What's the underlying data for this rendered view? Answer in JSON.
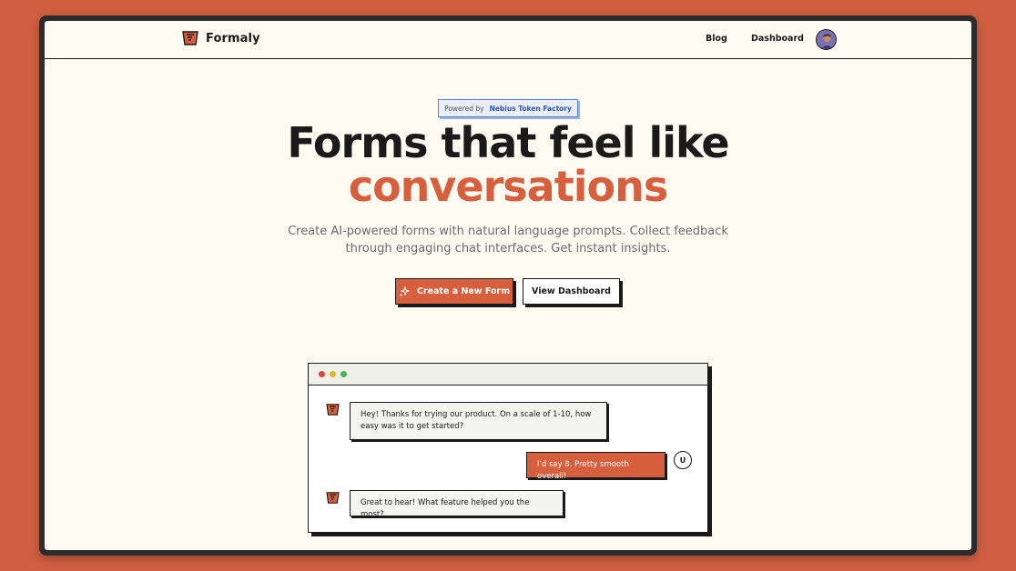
{
  "nav": {
    "brand": "Formaly",
    "links": [
      "Blog",
      "Dashboard"
    ],
    "avatar_icon": "user-avatar-icon"
  },
  "hero": {
    "badge_prefix": "Powered by",
    "badge_accent": "Nebius Token Factory",
    "title": "Forms that feel like",
    "title_accent": "conversations",
    "subtitle": "Create AI-powered forms with natural language prompts. Collect feedback through engaging chat interfaces. Get instant insights.",
    "primary_button": "Create a New Form",
    "secondary_button": "View Dashboard"
  },
  "chat": {
    "messages": [
      {
        "from": "bot",
        "text": "Hey! Thanks for trying our product. On a scale of 1-10, how easy was it to get started?"
      },
      {
        "from": "user",
        "text": "I'd say 8. Pretty smooth overall!"
      },
      {
        "from": "bot",
        "text": "Great to hear! What feature helped you the most?"
      }
    ],
    "user_initial": "U"
  },
  "colors": {
    "background": "#cf5f40",
    "accent": "#d85f3e",
    "page": "#fcfcf2",
    "ink": "#1a1a1a",
    "badge_accent": "#2d56c6"
  }
}
